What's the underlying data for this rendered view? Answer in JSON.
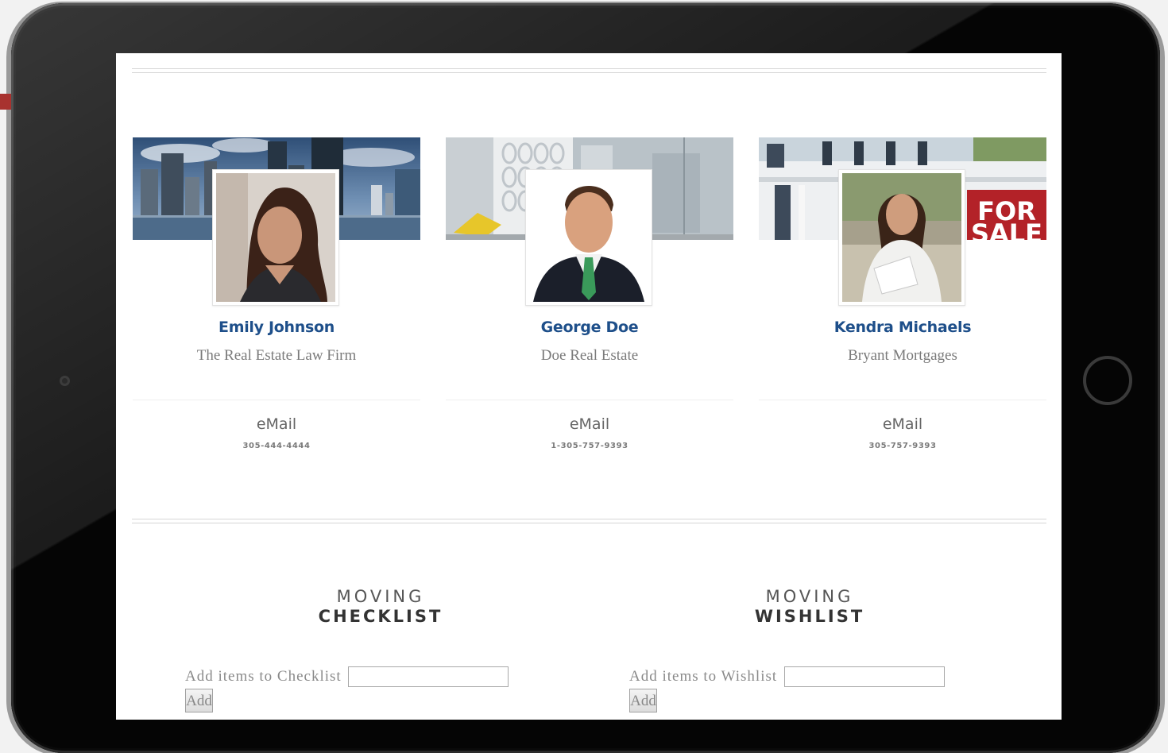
{
  "agents": [
    {
      "name": "Emily Johnson",
      "company": "The Real Estate Law Firm",
      "email": "eMail",
      "phone": "305-444-4444"
    },
    {
      "name": "George Doe",
      "company": "Doe Real Estate",
      "email": "eMail",
      "phone": "1-305-757-9393"
    },
    {
      "name": "Kendra Michaels",
      "company": "Bryant Mortgages",
      "email": "eMail",
      "phone": "305-757-9393"
    }
  ],
  "banner_sign": {
    "line1": "FOR",
    "line2": "SALE"
  },
  "checklist": {
    "title_top": "MOVING",
    "title_bottom": "CHECKLIST",
    "label": "Add items to Checklist",
    "button": "Add",
    "value": ""
  },
  "wishlist": {
    "title_top": "MOVING",
    "title_bottom": "WISHLIST",
    "label": "Add items to Wishlist",
    "button": "Add",
    "value": ""
  },
  "colors": {
    "name_link": "#1e4f8a",
    "accent_red": "#a8322f"
  }
}
